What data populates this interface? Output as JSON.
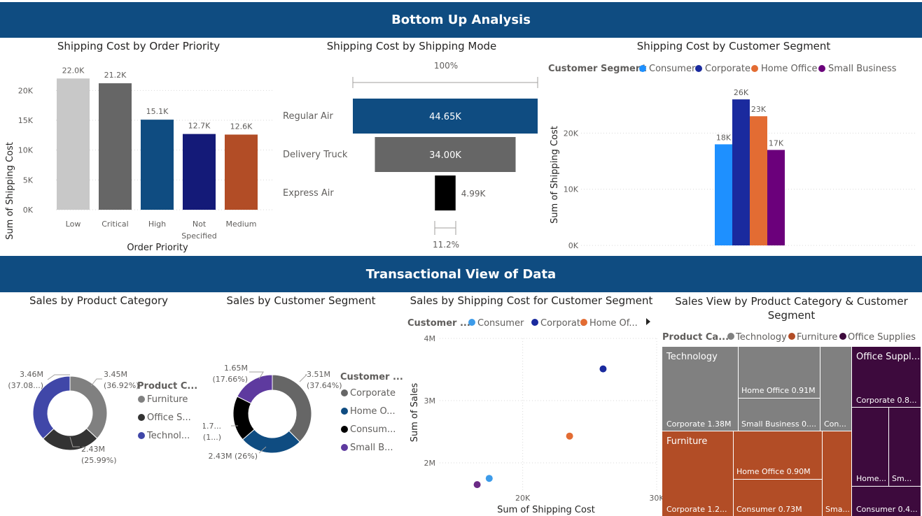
{
  "banners": {
    "top": "Bottom Up Analysis",
    "middle": "Transactional View of Data"
  },
  "colors": {
    "banner": "#0f4c81",
    "grid": "#c8c6c4"
  },
  "chart_data": [
    {
      "type": "bar",
      "title": "Shipping Cost by Order Priority",
      "xlabel": "Order Priority",
      "ylabel": "Sum of Shipping Cost",
      "categories": [
        "Low",
        "Critical",
        "High",
        "Not Specified",
        "Medium"
      ],
      "category_lines": [
        [
          "Low"
        ],
        [
          "Critical"
        ],
        [
          "High"
        ],
        [
          "Not",
          "Specified"
        ],
        [
          "Medium"
        ]
      ],
      "values": [
        22.0,
        21.2,
        15.1,
        12.7,
        12.6
      ],
      "labels": [
        "22.0K",
        "21.2K",
        "15.1K",
        "12.7K",
        "12.6K"
      ],
      "colors": [
        "#c8c8c8",
        "#666666",
        "#0f4c81",
        "#141a78",
        "#b24d26"
      ],
      "ylim": [
        0,
        22.5
      ],
      "yticks": [
        0,
        5,
        10,
        15,
        20
      ],
      "ytick_labels": [
        "0K",
        "5K",
        "10K",
        "15K",
        "20K"
      ],
      "grid": true
    },
    {
      "type": "funnel",
      "title": "Shipping Cost by Shipping Mode",
      "categories": [
        "Regular Air",
        "Delivery Truck",
        "Express Air"
      ],
      "values": [
        44.65,
        34.0,
        4.99
      ],
      "labels": [
        "44.65K",
        "34.00K",
        "4.99K"
      ],
      "colors": [
        "#0f4c81",
        "#666666",
        "#000000"
      ],
      "top_percent": "100%",
      "bottom_percent": "11.2%"
    },
    {
      "type": "bar",
      "title": "Shipping Cost by Customer Segment",
      "ylabel": "Sum of Shipping Cost",
      "legend_title": "Customer Segment",
      "series": [
        {
          "name": "Consumer",
          "value": 18,
          "label": "18K",
          "color": "#1e90ff"
        },
        {
          "name": "Corporate",
          "value": 26,
          "label": "26K",
          "color": "#1a2a9e"
        },
        {
          "name": "Home Office",
          "value": 23,
          "label": "23K",
          "color": "#e36c33"
        },
        {
          "name": "Small Business",
          "value": 17,
          "label": "17K",
          "color": "#6b007b"
        }
      ],
      "ylim": [
        0,
        30
      ],
      "yticks": [
        0,
        10,
        20
      ],
      "ytick_labels": [
        "0K",
        "10K",
        "20K"
      ],
      "legend_position": "top-left",
      "grid": true
    },
    {
      "type": "pie",
      "title": "Sales by Product Category",
      "legend_title": "Product C...",
      "legend": [
        "Furniture",
        "Office S...",
        "Technol..."
      ],
      "slices": [
        {
          "name": "Furniture",
          "value": 36.92,
          "color": "#808080",
          "label": [
            "3.45M",
            "(36.92%)"
          ]
        },
        {
          "name": "Office Supplies",
          "value": 25.99,
          "color": "#333333",
          "label": [
            "2.43M",
            "(25.99%)"
          ]
        },
        {
          "name": "Technology",
          "value": 37.08,
          "color": "#4047a8",
          "label": [
            "3.46M",
            "(37.08...)"
          ]
        }
      ]
    },
    {
      "type": "pie",
      "title": "Sales by Customer Segment",
      "legend_title": "Customer ...",
      "legend": [
        "Corporate",
        "Home O...",
        "Consum...",
        "Small B..."
      ],
      "slices": [
        {
          "name": "Corporate",
          "value": 37.64,
          "color": "#666666",
          "label": [
            "3.51M",
            "(37.64%)"
          ]
        },
        {
          "name": "Home Office",
          "value": 26.0,
          "color": "#0f4c81",
          "label": [
            "2.43M (26%)"
          ]
        },
        {
          "name": "Consumer",
          "value": 18.7,
          "color": "#000000",
          "label": [
            "1.7...",
            "(1...)"
          ]
        },
        {
          "name": "Small Business",
          "value": 17.66,
          "color": "#5e3a9f",
          "label": [
            "1.65M",
            "(17.66%)"
          ]
        }
      ]
    },
    {
      "type": "scatter",
      "title": "Sales by Shipping Cost for Customer Segment",
      "xlabel": "Sum of Shipping Cost",
      "ylabel": "Sum of Sales",
      "legend_title": "Customer ...",
      "legend": [
        {
          "name": "Consumer",
          "color": "#3d9be9"
        },
        {
          "name": "Corporate",
          "color": "#1a2a9e"
        },
        {
          "name": "Home Of...",
          "color": "#e36c33"
        }
      ],
      "points": [
        {
          "series": "Consumer",
          "x": 17.5,
          "y": 1.75,
          "color": "#3d9be9"
        },
        {
          "series": "Corporate",
          "x": 26,
          "y": 3.51,
          "color": "#1a2a9e"
        },
        {
          "series": "Home Office",
          "x": 23.5,
          "y": 2.43,
          "color": "#e36c33"
        },
        {
          "series": "Small Business",
          "x": 16.6,
          "y": 1.65,
          "color": "#6b2a86"
        }
      ],
      "xlim": [
        13.8,
        30
      ],
      "ylim": [
        1.55,
        4
      ],
      "xticks": [
        20,
        30
      ],
      "xtick_labels": [
        "20K",
        "30K"
      ],
      "yticks": [
        2,
        3,
        4
      ],
      "ytick_labels": [
        "2M",
        "3M",
        "4M"
      ]
    },
    {
      "type": "treemap",
      "title": "Sales View by Product Category & Customer Segment",
      "title_lines": [
        "Sales View by Product Category & Customer",
        "Segment"
      ],
      "legend_title": "Product Ca...",
      "legend": [
        {
          "name": "Technology",
          "color": "#808080"
        },
        {
          "name": "Furniture",
          "color": "#b24d26"
        },
        {
          "name": "Office Supplies",
          "color": "#3d0a3d"
        }
      ],
      "groups": [
        "Technology",
        "Furniture",
        "Office Suppl..."
      ],
      "cells": [
        "Corporate 1.38M",
        "Home Office 0.91M",
        "Small Business 0....",
        "Con...",
        "Corporate 1.2...",
        "Home Office 0.90M",
        "Consumer 0.73M",
        "Sma...",
        "Corporate 0.8...",
        "Home...",
        "Sm...",
        "Consumer 0.4..."
      ]
    }
  ]
}
